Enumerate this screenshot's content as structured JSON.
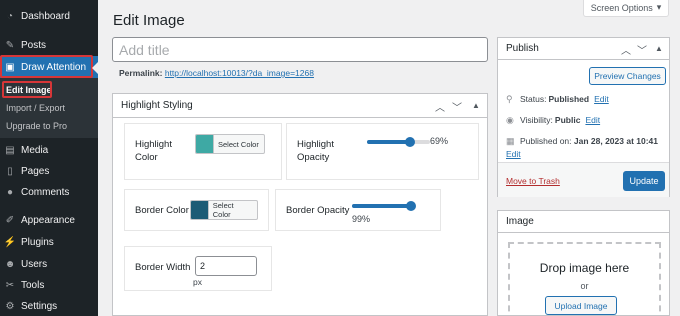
{
  "screen_options": {
    "label": "Screen Options",
    "arrow": "▾"
  },
  "sidebar": {
    "items": [
      {
        "label": "Dashboard",
        "icon": "dashboard-icon"
      },
      {
        "label": "Posts",
        "icon": "pin-icon"
      },
      {
        "label": "Draw Attention",
        "icon": "draw-attention-icon"
      },
      {
        "label": "Media",
        "icon": "media-icon"
      },
      {
        "label": "Pages",
        "icon": "pages-icon"
      },
      {
        "label": "Comments",
        "icon": "comments-icon"
      },
      {
        "label": "Appearance",
        "icon": "appearance-icon"
      },
      {
        "label": "Plugins",
        "icon": "plugins-icon"
      },
      {
        "label": "Users",
        "icon": "users-icon"
      },
      {
        "label": "Tools",
        "icon": "tools-icon"
      },
      {
        "label": "Settings",
        "icon": "settings-icon"
      }
    ],
    "submenu": [
      "Edit Image",
      "Import / Export",
      "Upgrade to Pro"
    ]
  },
  "page": {
    "title": "Edit Image",
    "title_placeholder": "Add title",
    "permalink_label": "Permalink:",
    "permalink_url": "http://localhost:10013/?da_image=1268"
  },
  "highlight": {
    "title": "Highlight Styling",
    "highlight_color_label": "Highlight Color",
    "highlight_color": "#3ea9a4",
    "select_color": "Select Color",
    "highlight_opacity_label": "Highlight Opacity",
    "highlight_opacity_value": "69%",
    "highlight_opacity": 0.69,
    "border_color_label": "Border Color",
    "border_color": "#1d5b75",
    "border_opacity_label": "Border Opacity",
    "border_opacity_value": "99%",
    "border_opacity": 0.99,
    "border_width_label": "Border Width",
    "border_width_value": "2",
    "border_width_unit": "px"
  },
  "publish": {
    "title": "Publish",
    "preview_label": "Preview Changes",
    "status_label": "Status:",
    "status_value": "Published",
    "visibility_label": "Visibility:",
    "visibility_value": "Public",
    "published_label": "Published on:",
    "published_value": "Jan 28, 2023 at 10:41",
    "edit_label": "Edit",
    "trash_label": "Move to Trash",
    "update_label": "Update"
  },
  "image": {
    "title": "Image",
    "drop_text": "Drop image here",
    "or_text": "or",
    "upload_label": "Upload Image"
  }
}
